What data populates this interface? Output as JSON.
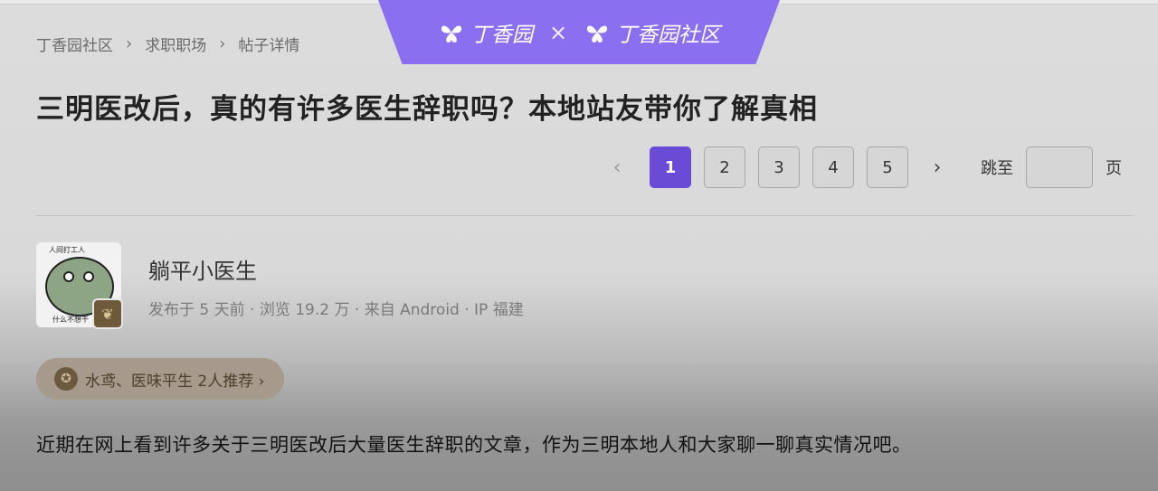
{
  "brand": {
    "left_logo": "丁香园",
    "times": "×",
    "right_logo": "丁香园社区",
    "color": "#8a6ff0"
  },
  "breadcrumb": [
    {
      "label": "丁香园社区"
    },
    {
      "label": "求职职场"
    },
    {
      "label": "帖子详情"
    }
  ],
  "breadcrumb_sep": "›",
  "post": {
    "title": "三明医改后，真的有许多医生辞职吗？本地站友带你了解真相",
    "author": {
      "name": "躺平小医生",
      "avatar_caption_top": "人间打工人",
      "avatar_caption_bottom": "什么不想干",
      "meta": "发布于 5 天前 · 浏览 19.2 万 · 来自 Android · IP 福建"
    },
    "recommend": "水鸢、医味平生 2人推荐 ›",
    "body": "近期在网上看到许多关于三明医改后大量医生辞职的文章，作为三明本地人和大家聊一聊真实情况吧。"
  },
  "pagination": {
    "prev_icon": "‹",
    "next_icon": "›",
    "pages": [
      "1",
      "2",
      "3",
      "4",
      "5"
    ],
    "current": "1",
    "jump_label": "跳至",
    "page_suffix": "页",
    "accent": "#6a4bd6"
  }
}
